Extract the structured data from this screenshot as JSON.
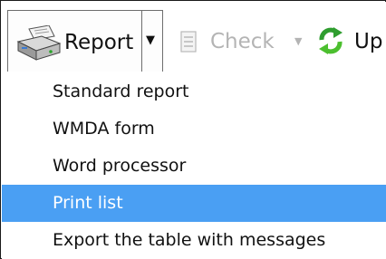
{
  "toolbar": {
    "report": {
      "label": "Report",
      "icon": "printer-icon",
      "dropdown_icon": "chevron-down-icon"
    },
    "check": {
      "label": "Check",
      "icon": "checklist-icon",
      "dropdown_icon": "chevron-down-icon",
      "enabled": false
    },
    "update": {
      "label": "Up",
      "icon": "refresh-icon"
    }
  },
  "menu": {
    "items": [
      {
        "label": "Standard report",
        "selected": false
      },
      {
        "label": "WMDA form",
        "selected": false
      },
      {
        "label": "Word processor",
        "selected": false
      },
      {
        "label": "Print list",
        "selected": true
      },
      {
        "label": "Export the table with messages",
        "selected": false
      }
    ]
  },
  "colors": {
    "selection": "#4a9ff3",
    "disabled_text": "#b4b4b4",
    "border": "#6e6e6e"
  }
}
